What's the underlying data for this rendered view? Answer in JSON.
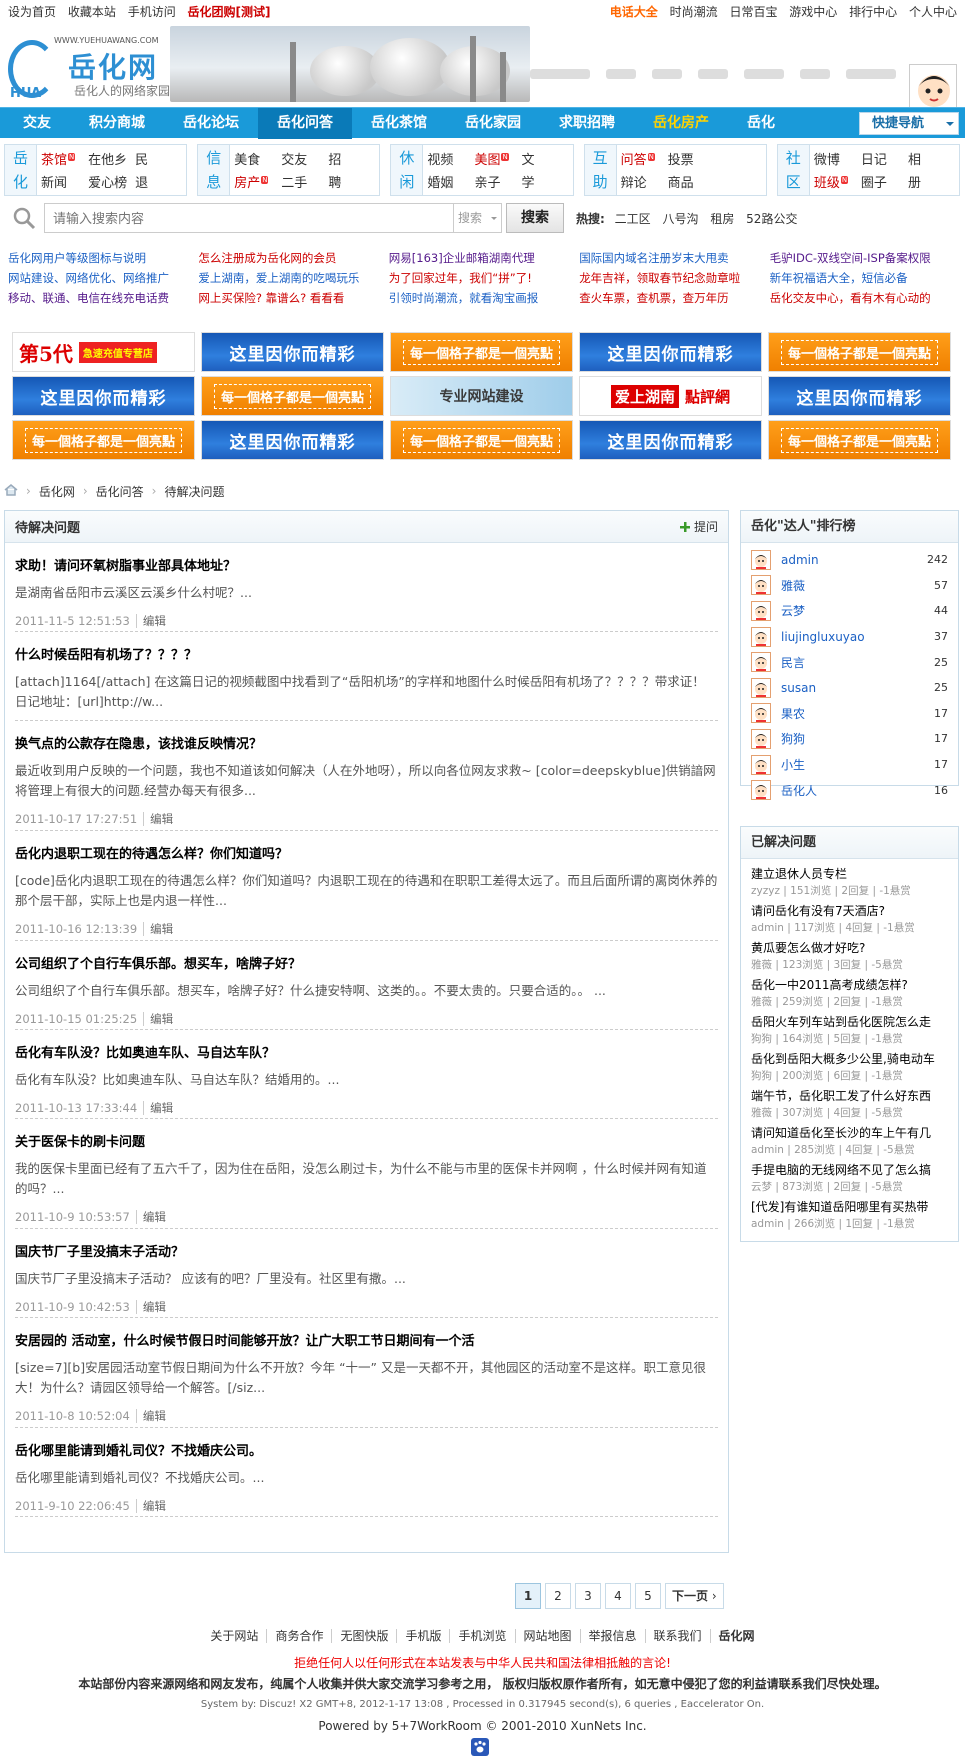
{
  "topbar": {
    "left": [
      "设为首页",
      "收藏本站",
      "手机访问"
    ],
    "promo": "岳化团购[测试]",
    "right_highlight": "电话大全",
    "right": [
      "时尚潮流",
      "日常百宝",
      "游戏中心",
      "排行中心",
      "个人中心"
    ]
  },
  "logo": {
    "url": "WWW.YUEHUAWANG.COM",
    "name": "岳化网",
    "slogan": "岳化人的网络家园",
    "mark": "HUA"
  },
  "nav": {
    "items": [
      "交友",
      "积分商城",
      "岳化论坛",
      "岳化问答",
      "岳化茶馆",
      "岳化家园",
      "求职招聘",
      "岳化房产",
      "岳化"
    ],
    "quick": "快捷导航"
  },
  "categories": [
    {
      "head": [
        "岳",
        "化"
      ],
      "links": [
        "茶馆",
        "在他乡",
        "民",
        "新闻",
        "爱心榜",
        "退"
      ]
    },
    {
      "head": [
        "信",
        "息"
      ],
      "links": [
        "美食",
        "交友",
        "招",
        "房产",
        "二手",
        "聘"
      ]
    },
    {
      "head": [
        "休",
        "闲"
      ],
      "links": [
        "视频",
        "美图",
        "文",
        "婚姻",
        "亲子",
        "学"
      ]
    },
    {
      "head": [
        "互",
        "助"
      ],
      "links": [
        "问答",
        "投票",
        "",
        "辩论",
        "商品",
        ""
      ]
    },
    {
      "head": [
        "社",
        "区"
      ],
      "links": [
        "微博",
        "日记",
        "相",
        "班级",
        "圈子",
        "册"
      ]
    }
  ],
  "search": {
    "placeholder": "请输入搜索内容",
    "scope": "搜索",
    "button": "搜索",
    "hot_label": "热搜:",
    "hot": [
      "二工区",
      "八号沟",
      "租房",
      "52路公交"
    ]
  },
  "ad_text": [
    "岳化网用户等级图标与说明",
    "怎么注册成为岳化网的会员",
    "网易[163]企业邮箱湖南代理",
    "国际国内域名注册岁末大甩卖",
    "毛驴IDC-双线空间-ISP备案权限",
    "网站建设、网络优化、网络推广",
    "爱上湖南，爱上湖南的吃喝玩乐",
    "为了回家过年，我们“拼”了!",
    "龙年吉祥，领取春节纪念勋章啦",
    "新年祝福语大全，短信必备",
    "移动、联通、电信在线充电话费",
    "网上买保险? 靠谱么? 看看看",
    "引领时尚潮流，就看淘宝画报",
    "查火车票，查机票，查万年历",
    "岳化交友中心，看有木有心动的"
  ],
  "banners": {
    "fifth": "第5代",
    "fifth_tag": "急速充值专营店",
    "blue": "这里因你而精彩",
    "orange": "每一個格子都是一個亮點",
    "web": "专业网站建设",
    "review": "爱上湖南",
    "review2": "點評網"
  },
  "breadcrumb": [
    "岳化网",
    "岳化问答",
    "待解决问题"
  ],
  "main": {
    "title": "待解决问题",
    "ask": "提问",
    "edit_label": "编辑",
    "questions": [
      {
        "title": "求助！请问环氧树脂事业部具体地址？",
        "summary": "是湖南省岳阳市云溪区云溪乡什么村呢？...",
        "date": "2011-11-5 12:51:53"
      },
      {
        "title": "什么时候岳阳有机场了？？？？",
        "summary": "[attach]1164[/attach] 在这篇日记的视频截图中找看到了“岳阳机场”的字样和地图什么时候岳阳有机场了？？？？带求证！  日记地址：[url]http://w...",
        "date": "2011-10-19 10:54:35"
      },
      {
        "title": "换气点的公款存在隐患，该找谁反映情况？",
        "summary": "最近收到用户反映的一个问题，我也不知道该如何解决（人在外地呀），所以向各位网友求救~ [color=deepskyblue]供销諳网将管理上有很大的问题.经营办每天有很多...",
        "date": "2011-10-17 17:27:51"
      },
      {
        "title": "岳化内退职工现在的待遇怎么样？你们知道吗？",
        "summary": "[code]岳化内退职工现在的待遇怎么样？你们知道吗？内退职工现在的待遇和在职职工差得太远了。而且后面所谓的离岗休养的那个层干部，实际上也是内退一样性...",
        "date": "2011-10-16 12:13:39"
      },
      {
        "title": "公司组织了个自行车俱乐部。想买车，啥牌子好？",
        "summary": "公司组织了个自行车俱乐部。想买车，啥牌子好？什么捷安特啊、这类的。。不要太贵的。只要合适的。。 ...",
        "date": "2011-10-15 01:25:25"
      },
      {
        "title": "岳化有车队没？比如奥迪车队、马自达车队？",
        "summary": "岳化有车队没？比如奥迪车队、马自达车队？结婚用的。...",
        "date": "2011-10-13 17:33:44"
      },
      {
        "title": "关于医保卡的刷卡问题",
        "summary": "我的医保卡里面已经有了五六千了，因为住在岳阳，没怎么刷过卡，为什么不能与市里的医保卡并网啊 ，什么时候并网有知道的吗？...",
        "date": "2011-10-9 10:53:57"
      },
      {
        "title": "国庆节厂子里没搞末子活动？",
        "summary": "国庆节厂子里没搞末子活动？ 应该有的吧？厂里没有。社区里有撒。...",
        "date": "2011-10-9 10:42:53"
      },
      {
        "title": "安居园的  活动室，什么时候节假日时间能够开放？让广大职工节日期间有一个活",
        "summary": "[size=7][b]安居园活动室节假日期间为什么不开放？今年 “十一” 又是一天都不开，其他园区的活动室不是这样。职工意见很大！为什么？请园区领导给一个解答。[/siz...",
        "date": "2011-10-8 10:52:04"
      },
      {
        "title": "岳化哪里能请到婚礼司仪？不找婚庆公司。",
        "summary": "岳化哪里能请到婚礼司仪？不找婚庆公司。...",
        "date": "2011-9-10 22:06:45"
      }
    ]
  },
  "pager": {
    "pages": [
      "1",
      "2",
      "3",
      "4",
      "5"
    ],
    "current": "1",
    "next": "下一页"
  },
  "ranking": {
    "title": "岳化\"达人\"排行榜",
    "users": [
      {
        "name": "admin",
        "count": "242"
      },
      {
        "name": "雅薇",
        "count": "57"
      },
      {
        "name": "云梦",
        "count": "44"
      },
      {
        "name": "liujingluxuyao",
        "count": "37"
      },
      {
        "name": "民言",
        "count": "25"
      },
      {
        "name": "susan",
        "count": "25"
      },
      {
        "name": "果农",
        "count": "17"
      },
      {
        "name": "狗狗",
        "count": "17"
      },
      {
        "name": "小生",
        "count": "17"
      },
      {
        "name": "岳化人",
        "count": "16"
      }
    ]
  },
  "solved": {
    "title": "已解决问题",
    "items": [
      {
        "title": "建立退休人员专栏",
        "meta": "zyzyz | 151浏览 | 2回复 | -1悬赏"
      },
      {
        "title": "请问岳化有没有7天酒店?",
        "meta": "admin | 117浏览 | 4回复 | -1悬赏"
      },
      {
        "title": "黄瓜要怎么做才好吃?",
        "meta": "雅薇 | 123浏览 | 3回复 | -5悬赏"
      },
      {
        "title": "岳化一中2011高考成绩怎样?",
        "meta": "雅薇 | 259浏览 | 2回复 | -1悬赏"
      },
      {
        "title": "岳阳火车列车站到岳化医院怎么走",
        "meta": "狗狗 | 164浏览 | 5回复 | -1悬赏"
      },
      {
        "title": "岳化到岳阳大概多少公里,骑电动车",
        "meta": "狗狗 | 200浏览 | 6回复 | -1悬赏"
      },
      {
        "title": "端午节，岳化职工发了什么好东西",
        "meta": "雅薇 | 307浏览 | 4回复 | -5悬赏"
      },
      {
        "title": "请问知道岳化至长沙的车上午有几",
        "meta": "admin | 285浏览 | 4回复 | -5悬赏"
      },
      {
        "title": "手提电脑的无线网络不见了怎么搞",
        "meta": "云梦 | 873浏览 | 2回复 | -5悬赏"
      },
      {
        "title": "[代发]有谁知道岳阳哪里有买热带",
        "meta": "admin | 266浏览 | 1回复 | -1悬赏"
      }
    ]
  },
  "footer": {
    "links": [
      "关于网站",
      "商务合作",
      "无图快版",
      "手机版",
      "手机浏览",
      "网站地图",
      "举报信息",
      "联系我们",
      "岳化网"
    ],
    "warning": "拒绝任何人以任何形式在本站发表与中华人民共和国法律相抵触的言论!",
    "notice": "本站部份内容来源网络和网友发布，纯属个人收集并供大家交流学习参考之用， 版权归版权原作者所有，如无意中侵犯了您的利益请联系我们尽快处理。",
    "system": "System by:  Discuz! X2  GMT+8, 2012-1-17 13:08 , Processed in 0.317945 second(s), 6 queries , Eaccelerator On.",
    "powered": "Powered by 5+7WorkRoom © 2001-2010 XunNets Inc."
  }
}
